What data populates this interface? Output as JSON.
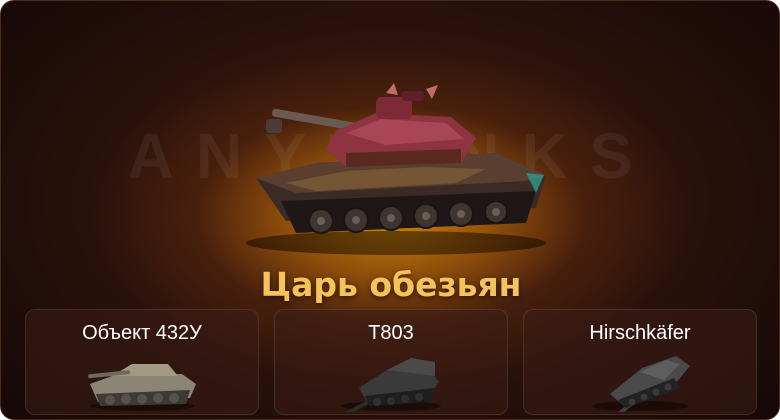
{
  "watermark": "ANYTANKS",
  "featured": {
    "name": "Царь обезьян",
    "image_icon": "tank-icon"
  },
  "tanks": [
    {
      "name": "Объект 432У",
      "image_icon": "tank-icon"
    },
    {
      "name": "T803",
      "image_icon": "tank-icon"
    },
    {
      "name": "Hirschkäfer",
      "image_icon": "tank-icon"
    }
  ],
  "colors": {
    "title": "#f6c25c",
    "glow": "#d68c0a",
    "background": "#2a120b"
  }
}
